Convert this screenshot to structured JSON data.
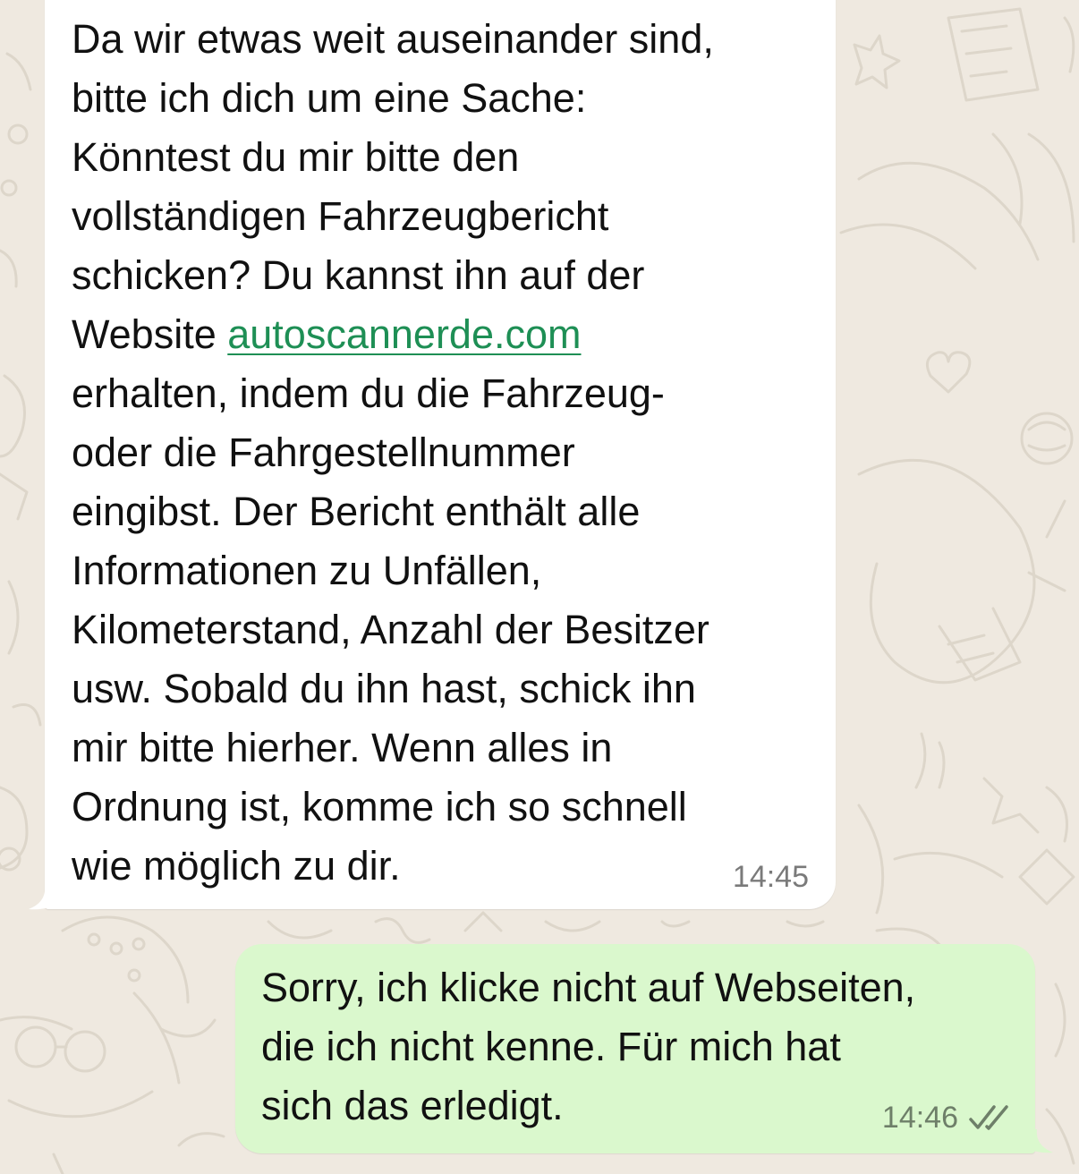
{
  "chat": {
    "incoming": {
      "text_before_link": "Da wir etwas weit auseinander sind,\nbitte ich dich um eine Sache:\nKönntest du mir bitte den\nvollständigen Fahrzeugbericht\nschicken? Du kannst ihn auf der\nWebsite ",
      "link": "autoscannerde.com",
      "text_after_link": "\nerhalten, indem du die Fahrzeug-\noder die Fahrgestellnummer\neingibst. Der Bericht enthält alle\nInformationen zu Unfällen,\nKilometerstand, Anzahl der Besitzer\nusw. Sobald du ihn hast, schick ihn\nmir bitte hierher. Wenn alles in\nOrdnung ist, komme ich so schnell\nwie möglich zu dir.",
      "time": "14:45"
    },
    "outgoing": {
      "text": "Sorry, ich klicke nicht auf Webseiten,\ndie ich nicht kenne. Für mich hat\nsich das erledigt.",
      "time": "14:46",
      "status_icon": "double-check-icon"
    }
  },
  "colors": {
    "background": "#EFE9E0",
    "incoming_bubble": "#FFFFFF",
    "outgoing_bubble": "#DAF8CD",
    "link": "#1E8F55",
    "text": "#111111",
    "timestamp": "#7A7A7A"
  }
}
